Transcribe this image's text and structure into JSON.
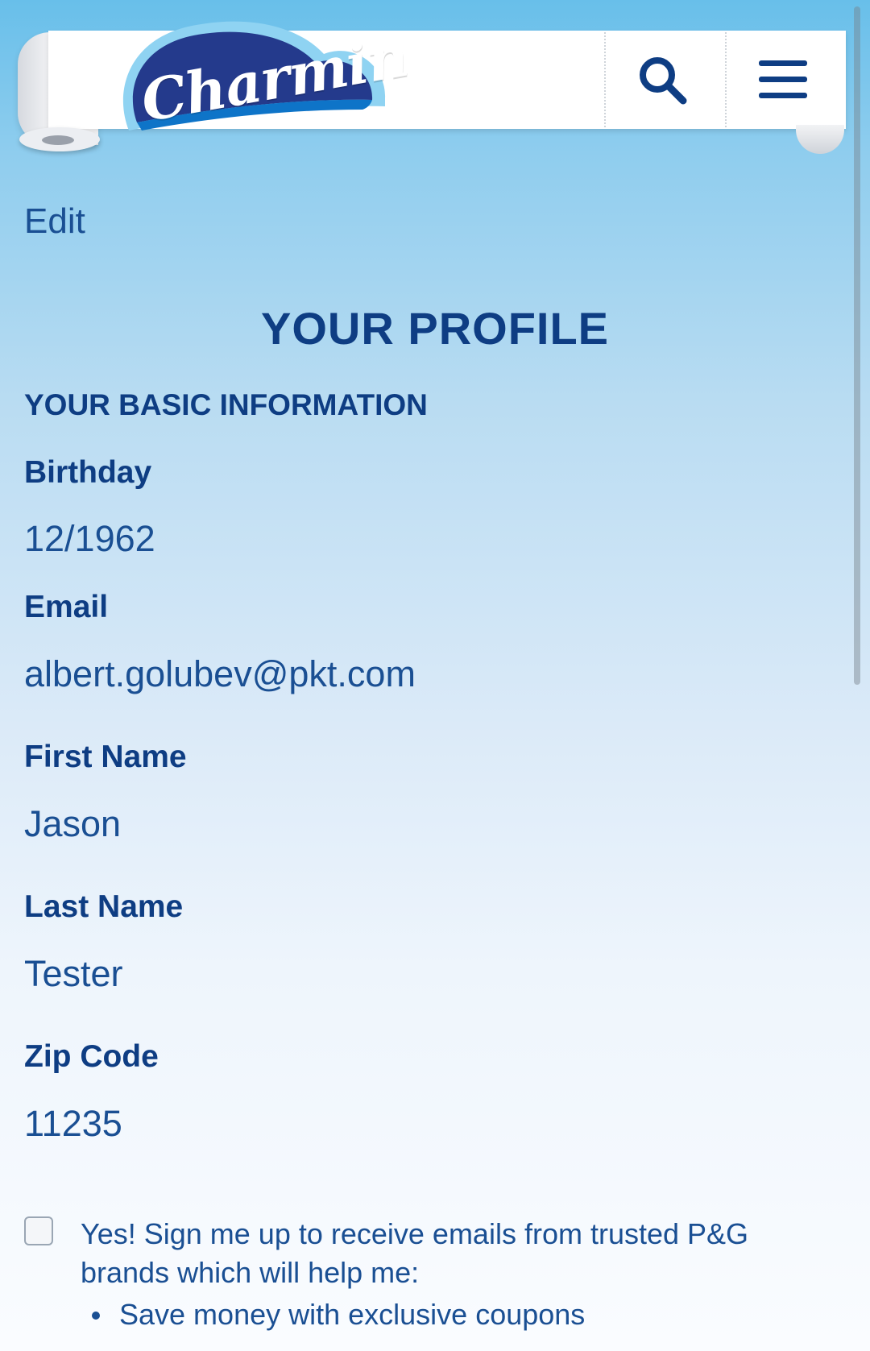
{
  "header": {
    "logo_text": "Charmin",
    "search_icon": "search-icon",
    "menu_icon": "hamburger-menu-icon"
  },
  "profile": {
    "edit_label": "Edit",
    "title": "YOUR PROFILE",
    "section_title": "YOUR BASIC INFORMATION",
    "fields": [
      {
        "label": "Birthday",
        "value": "12/1962"
      },
      {
        "label": "Email",
        "value": "albert.golubev@pkt.com"
      },
      {
        "label": "First Name",
        "value": "Jason"
      },
      {
        "label": "Last Name",
        "value": "Tester"
      },
      {
        "label": "Zip Code",
        "value": "11235"
      }
    ]
  },
  "optin": {
    "checked": false,
    "text": "Yes! Sign me up to receive emails from trusted P&G brands which will help me:",
    "bullets": [
      "Save money with exclusive coupons"
    ]
  },
  "colors": {
    "brand_blue": "#0e3d83",
    "link_blue": "#1a4f93",
    "sky_top": "#68bfea"
  }
}
